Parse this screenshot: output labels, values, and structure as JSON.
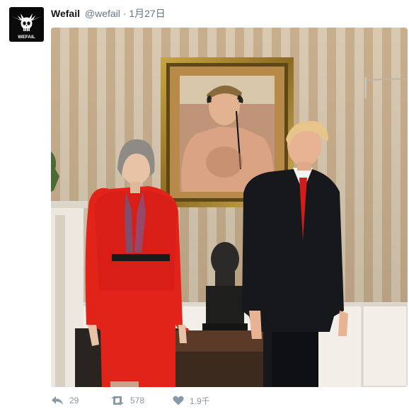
{
  "tweet": {
    "display_name": "Wefail",
    "handle": "@wefail",
    "separator": "·",
    "date": "1月27日",
    "avatar_text": "WEFAIL"
  },
  "actions": {
    "reply_count": "29",
    "retweet_count": "578",
    "like_count": "1.9千"
  },
  "icons": [
    "reply-icon",
    "retweet-icon",
    "heart-icon"
  ],
  "colors": {
    "action_gray": "#8899a6",
    "name": "#14171a",
    "meta": "#657786"
  }
}
